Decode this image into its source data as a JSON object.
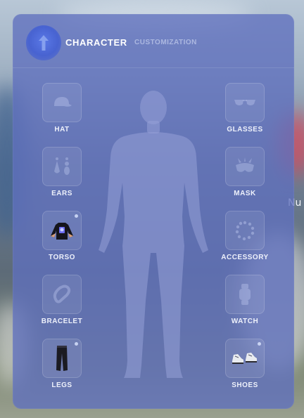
{
  "header": {
    "title": "CHARACTER",
    "subtitle": "CUSTOMIZATION",
    "logo_icon": "up-arrow-icon"
  },
  "edge_text": "Nu",
  "colors": {
    "panel": "#5f70be",
    "accent": "#4863d1"
  },
  "left_slots": [
    {
      "label": "HAT",
      "icon": "cap-icon",
      "equipped": false
    },
    {
      "label": "EARS",
      "icon": "earrings-icon",
      "equipped": false
    },
    {
      "label": "TORSO",
      "icon": "tshirt-icon",
      "equipped": true
    },
    {
      "label": "BRACELET",
      "icon": "bracelet-icon",
      "equipped": false
    },
    {
      "label": "LEGS",
      "icon": "pants-icon",
      "equipped": true
    }
  ],
  "right_slots": [
    {
      "label": "GLASSES",
      "icon": "glasses-icon",
      "equipped": false
    },
    {
      "label": "MASK",
      "icon": "mask-icon",
      "equipped": false
    },
    {
      "label": "ACCESSORY",
      "icon": "necklace-icon",
      "equipped": false
    },
    {
      "label": "WATCH",
      "icon": "watch-icon",
      "equipped": false
    },
    {
      "label": "SHOES",
      "icon": "sneakers-icon",
      "equipped": true
    }
  ]
}
